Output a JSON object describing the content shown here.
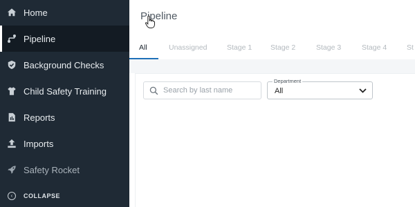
{
  "sidebar": {
    "items": [
      {
        "label": "Home",
        "icon": "home-icon"
      },
      {
        "label": "Pipeline",
        "icon": "pipeline-icon",
        "active": true
      },
      {
        "label": "Background Checks",
        "icon": "shield-check-icon"
      },
      {
        "label": "Child Safety Training",
        "icon": "shirt-icon"
      },
      {
        "label": "Reports",
        "icon": "report-icon"
      },
      {
        "label": "Imports",
        "icon": "upload-icon"
      },
      {
        "label": "Safety Rocket",
        "icon": "rocket-icon"
      }
    ],
    "collapse": {
      "label": "COLLAPSE",
      "icon": "collapse-icon"
    }
  },
  "main": {
    "title": "Pipeline",
    "tabs": [
      {
        "label": "All",
        "active": true
      },
      {
        "label": "Unassigned"
      },
      {
        "label": "Stage 1"
      },
      {
        "label": "Stage 2"
      },
      {
        "label": "Stage 3"
      },
      {
        "label": "Stage 4"
      },
      {
        "label": "St"
      }
    ],
    "search": {
      "placeholder": "Search by last name",
      "value": ""
    },
    "department": {
      "label": "Department",
      "value": "All"
    }
  },
  "colors": {
    "sidebar_bg": "#1f2a35",
    "sidebar_active_bg": "#131b23",
    "accent": "#1d6fb8"
  }
}
